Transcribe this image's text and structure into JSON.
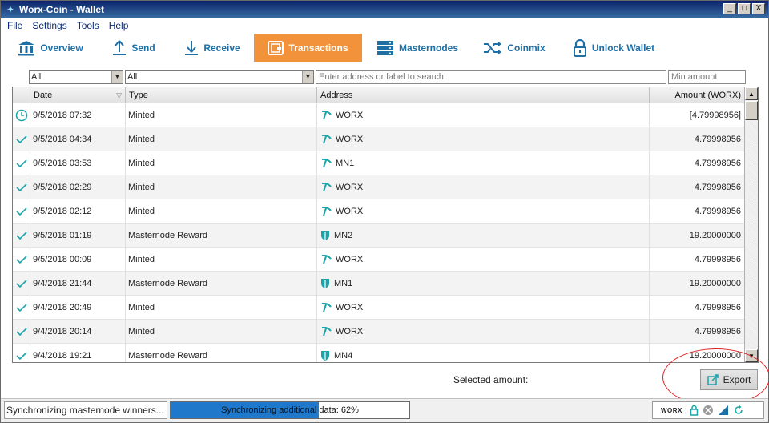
{
  "window": {
    "title": "Worx-Coin - Wallet",
    "buttons": [
      "_",
      "□",
      "X"
    ]
  },
  "menu": [
    {
      "label": "File"
    },
    {
      "label": "Settings"
    },
    {
      "label": "Tools"
    },
    {
      "label": "Help"
    }
  ],
  "toolbar": [
    {
      "label": "Overview",
      "icon": "bank-icon"
    },
    {
      "label": "Send",
      "icon": "upload-arrow-icon"
    },
    {
      "label": "Receive",
      "icon": "download-arrow-icon"
    },
    {
      "label": "Transactions",
      "icon": "wallet-icon",
      "active": true
    },
    {
      "label": "Masternodes",
      "icon": "server-icon"
    },
    {
      "label": "Coinmix",
      "icon": "shuffle-icon"
    },
    {
      "label": "Unlock Wallet",
      "icon": "padlock-icon"
    }
  ],
  "filters": {
    "date_select": "All",
    "type_select": "All",
    "address_placeholder": "Enter address or label to search",
    "amount_placeholder": "Min amount"
  },
  "table": {
    "columns": [
      "",
      "Date",
      "Type",
      "Address",
      "Amount (WORX)"
    ],
    "rows": [
      {
        "status": "pending",
        "date": "9/5/2018 07:32",
        "type": "Minted",
        "addr_icon": "mined",
        "address": "WORX",
        "amount": "[4.79998956]"
      },
      {
        "status": "confirmed",
        "date": "9/5/2018 04:34",
        "type": "Minted",
        "addr_icon": "mined",
        "address": "WORX",
        "amount": "4.79998956"
      },
      {
        "status": "confirmed",
        "date": "9/5/2018 03:53",
        "type": "Minted",
        "addr_icon": "mined",
        "address": "MN1",
        "amount": "4.79998956"
      },
      {
        "status": "confirmed",
        "date": "9/5/2018 02:29",
        "type": "Minted",
        "addr_icon": "mined",
        "address": "WORX",
        "amount": "4.79998956"
      },
      {
        "status": "confirmed",
        "date": "9/5/2018 02:12",
        "type": "Minted",
        "addr_icon": "mined",
        "address": "WORX",
        "amount": "4.79998956"
      },
      {
        "status": "confirmed",
        "date": "9/5/2018 01:19",
        "type": "Masternode Reward",
        "addr_icon": "masternode",
        "address": "MN2",
        "amount": "19.20000000"
      },
      {
        "status": "confirmed",
        "date": "9/5/2018 00:09",
        "type": "Minted",
        "addr_icon": "mined",
        "address": "WORX",
        "amount": "4.79998956"
      },
      {
        "status": "confirmed",
        "date": "9/4/2018 21:44",
        "type": "Masternode Reward",
        "addr_icon": "masternode",
        "address": "MN1",
        "amount": "19.20000000"
      },
      {
        "status": "confirmed",
        "date": "9/4/2018 20:49",
        "type": "Minted",
        "addr_icon": "mined",
        "address": "WORX",
        "amount": "4.79998956"
      },
      {
        "status": "confirmed",
        "date": "9/4/2018 20:14",
        "type": "Minted",
        "addr_icon": "mined",
        "address": "WORX",
        "amount": "4.79998956"
      },
      {
        "status": "confirmed",
        "date": "9/4/2018 19:21",
        "type": "Masternode Reward",
        "addr_icon": "masternode",
        "address": "MN4",
        "amount": "19.20000000"
      }
    ]
  },
  "selected_amount_label": "Selected amount:",
  "export_label": "Export",
  "status": {
    "text": "Synchronizing masternode winners...",
    "progress_label": "Synchronizing additional data: 62%",
    "progress": 0.62,
    "unit": "WORX",
    "icons": [
      "lock-icon",
      "network-icon",
      "signal-icon",
      "sync-icon"
    ]
  },
  "colors": {
    "accent": "#f2923a",
    "brand": "#1f6fa7",
    "teal": "#1ba3a8",
    "progress": "#1f78c9",
    "annotation": "#e02020"
  }
}
